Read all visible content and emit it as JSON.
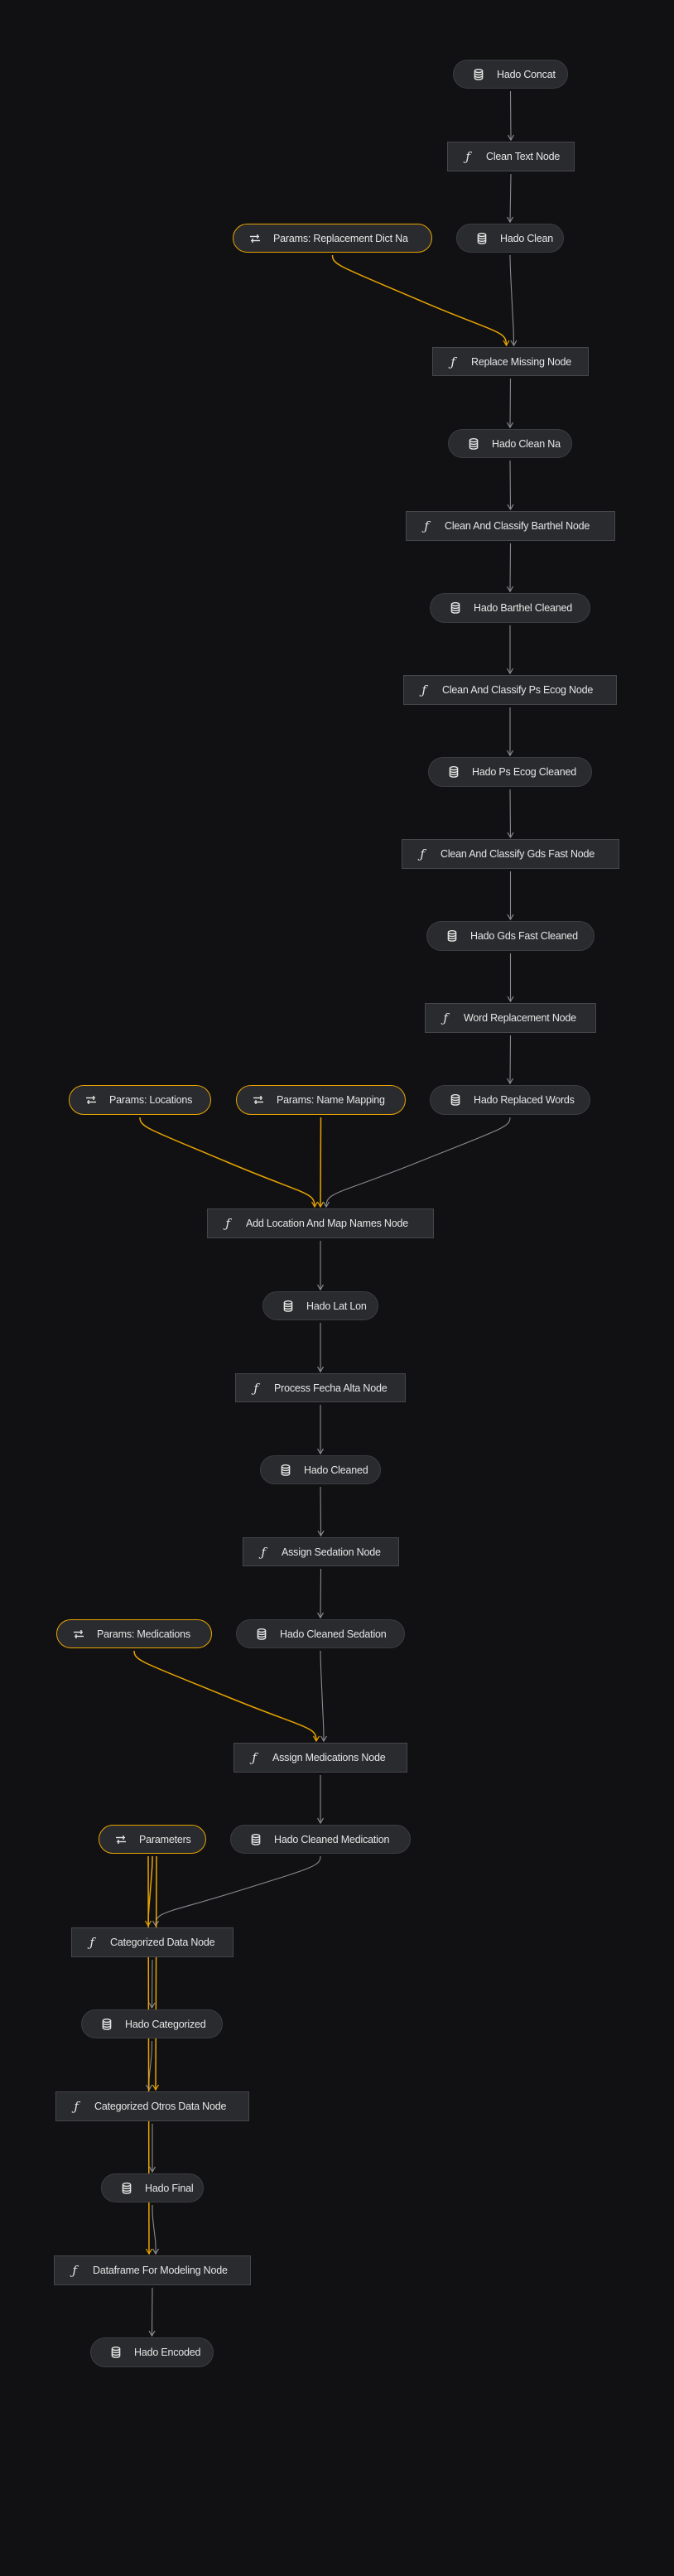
{
  "colors": {
    "background": "#111113",
    "node_fill": "#2a2b2e",
    "node_border": "#3c3d41",
    "parameter_accent": "#e8a400",
    "edge": "#8a8b8f",
    "text": "#e6e6e6"
  },
  "icons": {
    "dataset": "database-icon",
    "function": "function-icon",
    "parameters": "parameters-icon"
  },
  "nodes": [
    {
      "id": "hado_concat",
      "type": "dataset",
      "label": "Hado Concat"
    },
    {
      "id": "clean_text_node",
      "type": "function",
      "label": "Clean Text Node"
    },
    {
      "id": "params_replacement_dict_na",
      "type": "parameters",
      "label": "Params: Replacement Dict Na"
    },
    {
      "id": "hado_clean",
      "type": "dataset",
      "label": "Hado Clean"
    },
    {
      "id": "replace_missing_node",
      "type": "function",
      "label": "Replace Missing Node"
    },
    {
      "id": "hado_clean_na",
      "type": "dataset",
      "label": "Hado Clean Na"
    },
    {
      "id": "clean_classify_barthel_node",
      "type": "function",
      "label": "Clean And Classify Barthel Node"
    },
    {
      "id": "hado_barthel_cleaned",
      "type": "dataset",
      "label": "Hado Barthel Cleaned"
    },
    {
      "id": "clean_classify_ps_ecog_node",
      "type": "function",
      "label": "Clean And Classify Ps Ecog Node"
    },
    {
      "id": "hado_ps_ecog_cleaned",
      "type": "dataset",
      "label": "Hado Ps Ecog Cleaned"
    },
    {
      "id": "clean_classify_gds_fast_node",
      "type": "function",
      "label": "Clean And Classify Gds Fast Node"
    },
    {
      "id": "hado_gds_fast_cleaned",
      "type": "dataset",
      "label": "Hado Gds Fast Cleaned"
    },
    {
      "id": "word_replacement_node",
      "type": "function",
      "label": "Word Replacement Node"
    },
    {
      "id": "params_locations",
      "type": "parameters",
      "label": "Params: Locations"
    },
    {
      "id": "params_name_mapping",
      "type": "parameters",
      "label": "Params: Name Mapping"
    },
    {
      "id": "hado_replaced_words",
      "type": "dataset",
      "label": "Hado Replaced Words"
    },
    {
      "id": "add_location_map_names_node",
      "type": "function",
      "label": "Add Location And Map Names Node"
    },
    {
      "id": "hado_lat_lon",
      "type": "dataset",
      "label": "Hado Lat Lon"
    },
    {
      "id": "process_fecha_alta_node",
      "type": "function",
      "label": "Process Fecha Alta Node"
    },
    {
      "id": "hado_cleaned",
      "type": "dataset",
      "label": "Hado Cleaned"
    },
    {
      "id": "assign_sedation_node",
      "type": "function",
      "label": "Assign Sedation Node"
    },
    {
      "id": "params_medications",
      "type": "parameters",
      "label": "Params: Medications"
    },
    {
      "id": "hado_cleaned_sedation",
      "type": "dataset",
      "label": "Hado Cleaned Sedation"
    },
    {
      "id": "assign_medications_node",
      "type": "function",
      "label": "Assign Medications Node"
    },
    {
      "id": "parameters",
      "type": "parameters",
      "label": "Parameters"
    },
    {
      "id": "hado_cleaned_medication",
      "type": "dataset",
      "label": "Hado Cleaned Medication"
    },
    {
      "id": "categorized_data_node",
      "type": "function",
      "label": "Categorized Data Node"
    },
    {
      "id": "hado_categorized",
      "type": "dataset",
      "label": "Hado Categorized"
    },
    {
      "id": "categorized_otros_data_node",
      "type": "function",
      "label": "Categorized Otros Data Node"
    },
    {
      "id": "hado_final",
      "type": "dataset",
      "label": "Hado Final"
    },
    {
      "id": "dataframe_for_modeling_node",
      "type": "function",
      "label": "Dataframe For Modeling Node"
    },
    {
      "id": "hado_encoded",
      "type": "dataset",
      "label": "Hado Encoded"
    }
  ],
  "edges": [
    {
      "from": "hado_concat",
      "to": "clean_text_node"
    },
    {
      "from": "clean_text_node",
      "to": "hado_clean"
    },
    {
      "from": "params_replacement_dict_na",
      "to": "replace_missing_node"
    },
    {
      "from": "hado_clean",
      "to": "replace_missing_node"
    },
    {
      "from": "replace_missing_node",
      "to": "hado_clean_na"
    },
    {
      "from": "hado_clean_na",
      "to": "clean_classify_barthel_node"
    },
    {
      "from": "clean_classify_barthel_node",
      "to": "hado_barthel_cleaned"
    },
    {
      "from": "hado_barthel_cleaned",
      "to": "clean_classify_ps_ecog_node"
    },
    {
      "from": "clean_classify_ps_ecog_node",
      "to": "hado_ps_ecog_cleaned"
    },
    {
      "from": "hado_ps_ecog_cleaned",
      "to": "clean_classify_gds_fast_node"
    },
    {
      "from": "clean_classify_gds_fast_node",
      "to": "hado_gds_fast_cleaned"
    },
    {
      "from": "hado_gds_fast_cleaned",
      "to": "word_replacement_node"
    },
    {
      "from": "word_replacement_node",
      "to": "hado_replaced_words"
    },
    {
      "from": "params_locations",
      "to": "add_location_map_names_node"
    },
    {
      "from": "params_name_mapping",
      "to": "add_location_map_names_node"
    },
    {
      "from": "hado_replaced_words",
      "to": "add_location_map_names_node"
    },
    {
      "from": "add_location_map_names_node",
      "to": "hado_lat_lon"
    },
    {
      "from": "hado_lat_lon",
      "to": "process_fecha_alta_node"
    },
    {
      "from": "process_fecha_alta_node",
      "to": "hado_cleaned"
    },
    {
      "from": "hado_cleaned",
      "to": "assign_sedation_node"
    },
    {
      "from": "assign_sedation_node",
      "to": "hado_cleaned_sedation"
    },
    {
      "from": "params_medications",
      "to": "assign_medications_node"
    },
    {
      "from": "hado_cleaned_sedation",
      "to": "assign_medications_node"
    },
    {
      "from": "assign_medications_node",
      "to": "hado_cleaned_medication"
    },
    {
      "from": "parameters",
      "to": "categorized_data_node"
    },
    {
      "from": "hado_cleaned_medication",
      "to": "categorized_data_node"
    },
    {
      "from": "categorized_data_node",
      "to": "hado_categorized"
    },
    {
      "from": "hado_categorized",
      "to": "categorized_otros_data_node"
    },
    {
      "from": "parameters",
      "to": "categorized_otros_data_node"
    },
    {
      "from": "categorized_otros_data_node",
      "to": "hado_final"
    },
    {
      "from": "parameters",
      "to": "dataframe_for_modeling_node"
    },
    {
      "from": "hado_final",
      "to": "dataframe_for_modeling_node"
    },
    {
      "from": "dataframe_for_modeling_node",
      "to": "hado_encoded"
    }
  ]
}
